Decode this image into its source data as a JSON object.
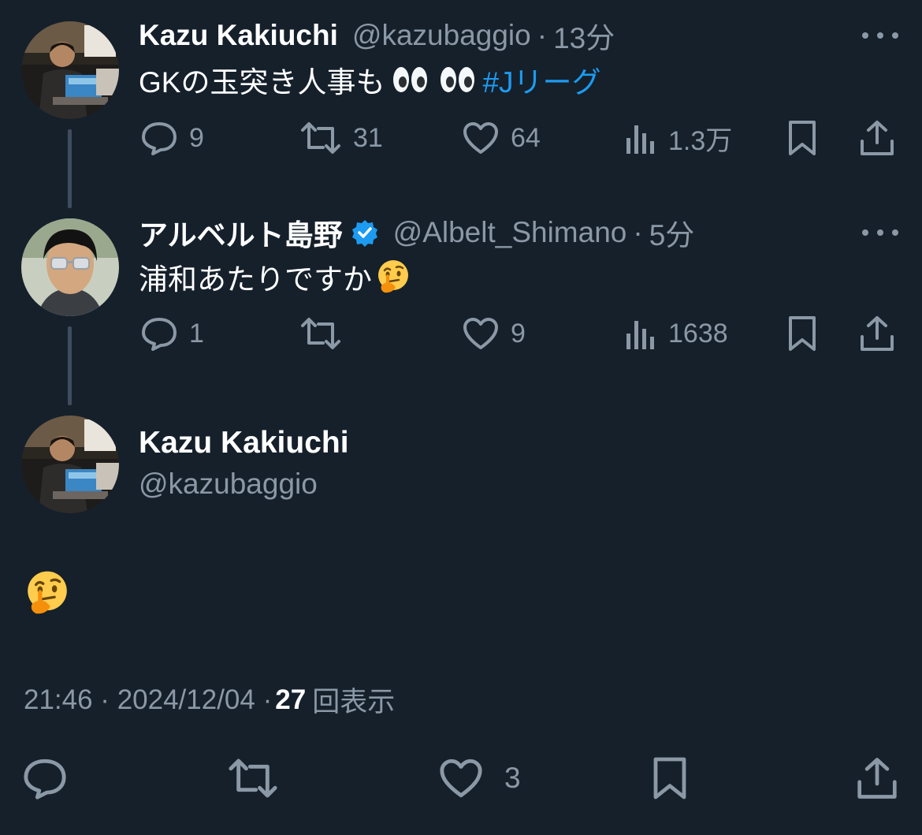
{
  "tweets": [
    {
      "name": "Kazu Kakiuchi",
      "handle": "@kazubaggio",
      "sep": "·",
      "time": "13分",
      "text": "GKの玉突き人事も",
      "hashtag": "#Jリーグ",
      "replies": "9",
      "retweets": "31",
      "likes": "64",
      "views": "1.3万"
    },
    {
      "name": "アルベルト島野",
      "handle": "@Albelt_Shimano",
      "sep": "·",
      "time": "5分",
      "text": "浦和あたりですか",
      "replies": "1",
      "retweets": "",
      "likes": "9",
      "views": "1638"
    }
  ],
  "main": {
    "name": "Kazu Kakiuchi",
    "handle": "@kazubaggio",
    "timestamp": "21:46 · 2024/12/04 · ",
    "views_count": "27",
    "views_label": "回表示",
    "likes": "3"
  },
  "colors": {
    "background": "#15202b",
    "secondary_text": "#8b98a5",
    "link": "#1d9bf0",
    "verified": "#1d9bf0"
  },
  "icons": {
    "reply": "reply-icon",
    "retweet": "retweet-icon",
    "like": "heart-icon",
    "views": "views-icon",
    "bookmark": "bookmark-icon",
    "share": "share-icon",
    "more": "more-icon"
  }
}
